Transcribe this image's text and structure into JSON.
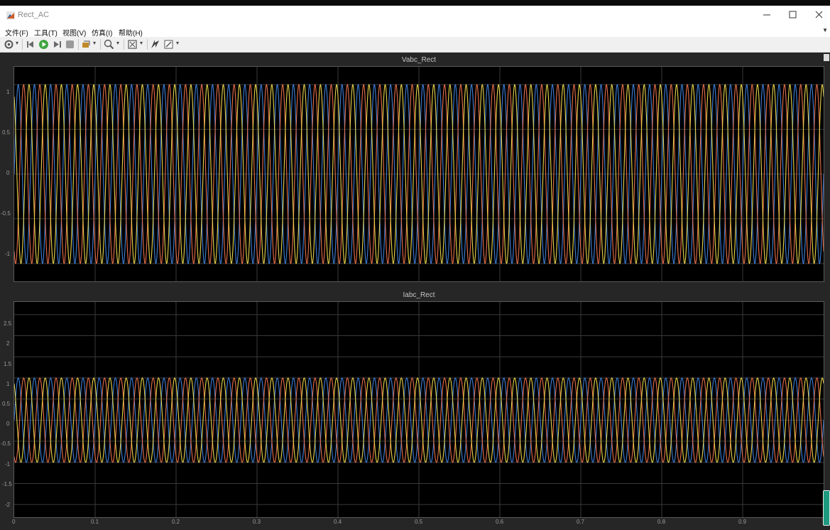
{
  "window": {
    "title": "Rect_AC"
  },
  "menu": [
    {
      "label": "文件(F)"
    },
    {
      "label": "工具(T)"
    },
    {
      "label": "视图(V)"
    },
    {
      "label": "仿真(I)"
    },
    {
      "label": "帮助(H)"
    }
  ],
  "toolbar": {
    "icons": [
      "settings-icon",
      "step-back-icon",
      "run-icon",
      "step-forward-icon",
      "stop-icon",
      "highlight-icon",
      "zoom-icon",
      "fit-to-view-icon",
      "cursor-measure-icon",
      "edit-style-icon"
    ]
  },
  "plots": [
    {
      "title": "Vabc_Rect",
      "yticks": [
        "1",
        "0.5",
        "0",
        "-0.5",
        "-1"
      ]
    },
    {
      "title": "Iabc_Rect",
      "yticks": [
        "2.5",
        "2",
        "1.5",
        "1",
        "0.5",
        "0",
        "-0.5",
        "-1",
        "-1.5",
        "-2"
      ],
      "xticks": [
        "0",
        "0.1",
        "0.2",
        "0.3",
        "0.4",
        "0.5",
        "0.6",
        "0.7",
        "0.8",
        "0.9"
      ]
    }
  ],
  "chart_data": [
    {
      "type": "line",
      "title": "Vabc_Rect",
      "xlim": [
        0,
        1
      ],
      "ylim": [
        -1.2,
        1.2
      ],
      "grid": true,
      "series": [
        {
          "color": "#3f7fd8",
          "amplitude": 1,
          "frequency_hz": 50,
          "phase_deg": 0
        },
        {
          "color": "#e8704a",
          "amplitude": 1,
          "frequency_hz": 50,
          "phase_deg": -120
        },
        {
          "color": "#e8d44a",
          "amplitude": 1,
          "frequency_hz": 50,
          "phase_deg": 120
        }
      ]
    },
    {
      "type": "line",
      "title": "Iabc_Rect",
      "xlim": [
        0,
        1
      ],
      "ylim": [
        -2.3,
        2.8
      ],
      "grid": true,
      "series": [
        {
          "color": "#3f7fd8",
          "amplitude": 1,
          "frequency_hz": 50,
          "phase_deg": 0
        },
        {
          "color": "#e8704a",
          "amplitude": 1,
          "frequency_hz": 50,
          "phase_deg": -120
        },
        {
          "color": "#e8d44a",
          "amplitude": 1,
          "frequency_hz": 50,
          "phase_deg": 120
        }
      ]
    }
  ]
}
